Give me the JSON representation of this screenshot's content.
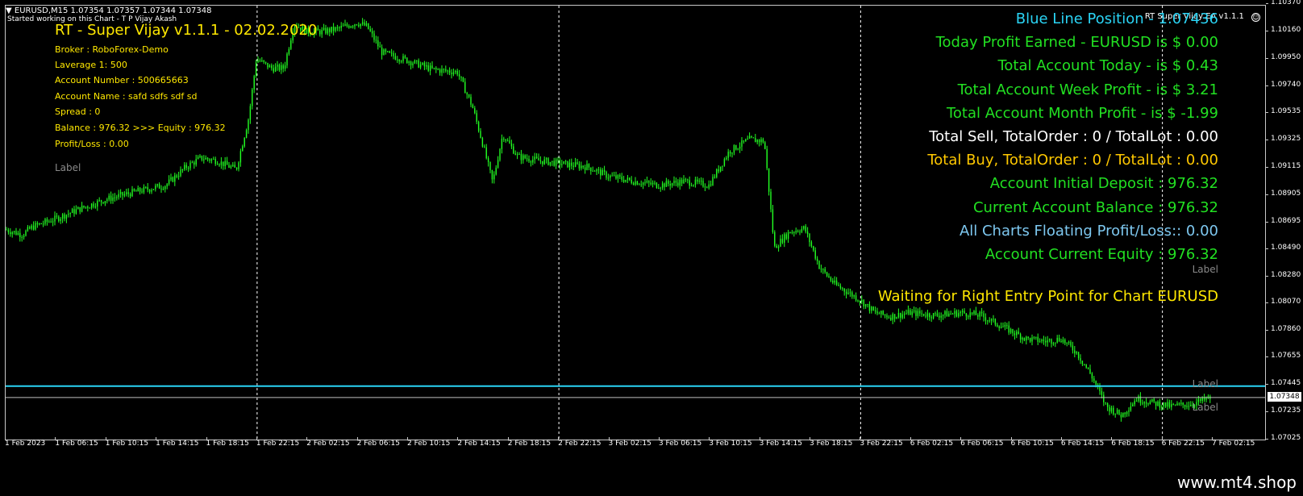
{
  "chart": {
    "header": "EURUSD,M15  1.07354 1.07357 1.07344 1.07348",
    "sub": "Started working on this Chart - T P Vijay Akash",
    "ea_badge": "RT Super Vijay EA v1.1.1",
    "smiley": "☺",
    "menu_icon": "triangle-down-icon"
  },
  "ea": {
    "title": "RT - Super Vijay v1.1.1 - 02.02.2020",
    "broker": "Broker : RoboForex-Demo",
    "leverage": "Laverage  1: 500",
    "account_number": "Account Number   : 500665663",
    "account_name": "Account Name   : safd     sdfs sdf  sd",
    "spread": "Spread : 0",
    "balance": "Balance :  976.32     >>> Equity : 976.32",
    "profit_loss": "Profit/Loss : 0.00",
    "label_left": "Label"
  },
  "stats": [
    {
      "text": "Blue Line Position  - 1.07436",
      "color": "#2ad4f5"
    },
    {
      "text": "Today Profit Earned - EURUSD is $ 0.00",
      "color": "#22e022"
    },
    {
      "text": "Total Account Today - is $ 0.43",
      "color": "#22e022"
    },
    {
      "text": "Total Account Week Profit - is $ 3.21",
      "color": "#22e022"
    },
    {
      "text": "Total Account Month Profit - is $ -1.99",
      "color": "#22e022"
    },
    {
      "text": "Total Sell, TotalOrder : 0 / TotalLot : 0.00",
      "color": "#ffffff"
    },
    {
      "text": "Total Buy, TotalOrder : 0 / TotalLot : 0.00",
      "color": "#ffc800"
    },
    {
      "text": "Account Initial Deposit : 976.32",
      "color": "#22e022"
    },
    {
      "text": "Current Account Balance : 976.32",
      "color": "#22e022"
    },
    {
      "text": "All Charts Floating Profit/Loss::       0.00",
      "color": "#7ec8f0"
    },
    {
      "text": "Account Current Equity : 976.32",
      "color": "#22e022"
    }
  ],
  "label_right": "Label",
  "waiting_message": "Waiting for Right Entry Point for Chart EURUSD",
  "label_blue_line": "Label",
  "label_price_line": "Label",
  "current_price": "1.07348",
  "blue_line_price": 1.07436,
  "watermark": "www.mt4.shop",
  "colors": {
    "candle": "#22ff22",
    "blue_line": "#2ad4f5",
    "price_line": "#bfbfbf",
    "separator": "#ffffff"
  },
  "chart_data": {
    "type": "line",
    "ylim": [
      1.07025,
      1.1036
    ],
    "price_ticks": [
      "1.10370",
      "1.10160",
      "1.09950",
      "1.09740",
      "1.09535",
      "1.09325",
      "1.09115",
      "1.08905",
      "1.08695",
      "1.08490",
      "1.08280",
      "1.08070",
      "1.07860",
      "1.07655",
      "1.07445",
      "1.07235",
      "1.07025"
    ],
    "time_ticks": [
      "1 Feb 2023",
      "1 Feb 06:15",
      "1 Feb 10:15",
      "1 Feb 14:15",
      "1 Feb 18:15",
      "1 Feb 22:15",
      "2 Feb 02:15",
      "2 Feb 06:15",
      "2 Feb 10:15",
      "2 Feb 14:15",
      "2 Feb 18:15",
      "2 Feb 22:15",
      "3 Feb 02:15",
      "3 Feb 06:15",
      "3 Feb 10:15",
      "3 Feb 14:15",
      "3 Feb 18:15",
      "3 Feb 22:15",
      "6 Feb 02:15",
      "6 Feb 06:15",
      "6 Feb 10:15",
      "6 Feb 14:15",
      "6 Feb 18:15",
      "6 Feb 22:15",
      "7 Feb 02:15"
    ],
    "separators": [
      "1 Feb 22:15",
      "2 Feb 22:15",
      "3 Feb 22:15",
      "6 Feb 22:15"
    ],
    "x_index_range": [
      0,
      24
    ],
    "close_path": [
      [
        0.0,
        1.0864
      ],
      [
        0.35,
        1.086
      ],
      [
        0.55,
        1.0866
      ],
      [
        1.0,
        1.0872
      ],
      [
        1.5,
        1.088
      ],
      [
        2.0,
        1.0887
      ],
      [
        2.6,
        1.0893
      ],
      [
        3.2,
        1.0898
      ],
      [
        3.6,
        1.0912
      ],
      [
        3.9,
        1.0919
      ],
      [
        4.2,
        1.0917
      ],
      [
        4.6,
        1.091
      ],
      [
        4.85,
        1.095
      ],
      [
        5.0,
        1.0995
      ],
      [
        5.3,
        1.0988
      ],
      [
        5.55,
        1.0988
      ],
      [
        5.75,
        1.1022
      ],
      [
        6.0,
        1.1016
      ],
      [
        6.3,
        1.1016
      ],
      [
        6.6,
        1.1018
      ],
      [
        7.0,
        1.1023
      ],
      [
        7.2,
        1.102
      ],
      [
        7.5,
        1.1
      ],
      [
        8.0,
        1.0994
      ],
      [
        8.5,
        1.0987
      ],
      [
        9.0,
        1.0985
      ],
      [
        9.3,
        1.0958
      ],
      [
        9.5,
        1.093
      ],
      [
        9.7,
        1.09
      ],
      [
        9.9,
        1.0937
      ],
      [
        10.2,
        1.092
      ],
      [
        10.6,
        1.0917
      ],
      [
        11.0,
        1.0915
      ],
      [
        11.6,
        1.0912
      ],
      [
        12.0,
        1.0905
      ],
      [
        12.5,
        1.0901
      ],
      [
        13.0,
        1.0898
      ],
      [
        13.5,
        1.0901
      ],
      [
        14.0,
        1.0898
      ],
      [
        14.4,
        1.0924
      ],
      [
        14.8,
        1.0933
      ],
      [
        15.1,
        1.0932
      ],
      [
        15.3,
        1.085
      ],
      [
        15.6,
        1.0862
      ],
      [
        15.9,
        1.0865
      ],
      [
        16.2,
        1.0835
      ],
      [
        16.5,
        1.0822
      ],
      [
        17.0,
        1.081
      ],
      [
        17.3,
        1.08
      ],
      [
        17.6,
        1.0797
      ],
      [
        18.0,
        1.08
      ],
      [
        18.5,
        1.0798
      ],
      [
        19.0,
        1.08
      ],
      [
        19.4,
        1.0798
      ],
      [
        19.8,
        1.079
      ],
      [
        20.3,
        1.078
      ],
      [
        20.7,
        1.0778
      ],
      [
        21.0,
        1.078
      ],
      [
        21.3,
        1.077
      ],
      [
        21.6,
        1.0752
      ],
      [
        21.9,
        1.0728
      ],
      [
        22.2,
        1.0721
      ],
      [
        22.5,
        1.0734
      ],
      [
        22.8,
        1.0731
      ],
      [
        23.2,
        1.0728
      ],
      [
        23.6,
        1.073
      ],
      [
        24.0,
        1.07348
      ]
    ]
  }
}
